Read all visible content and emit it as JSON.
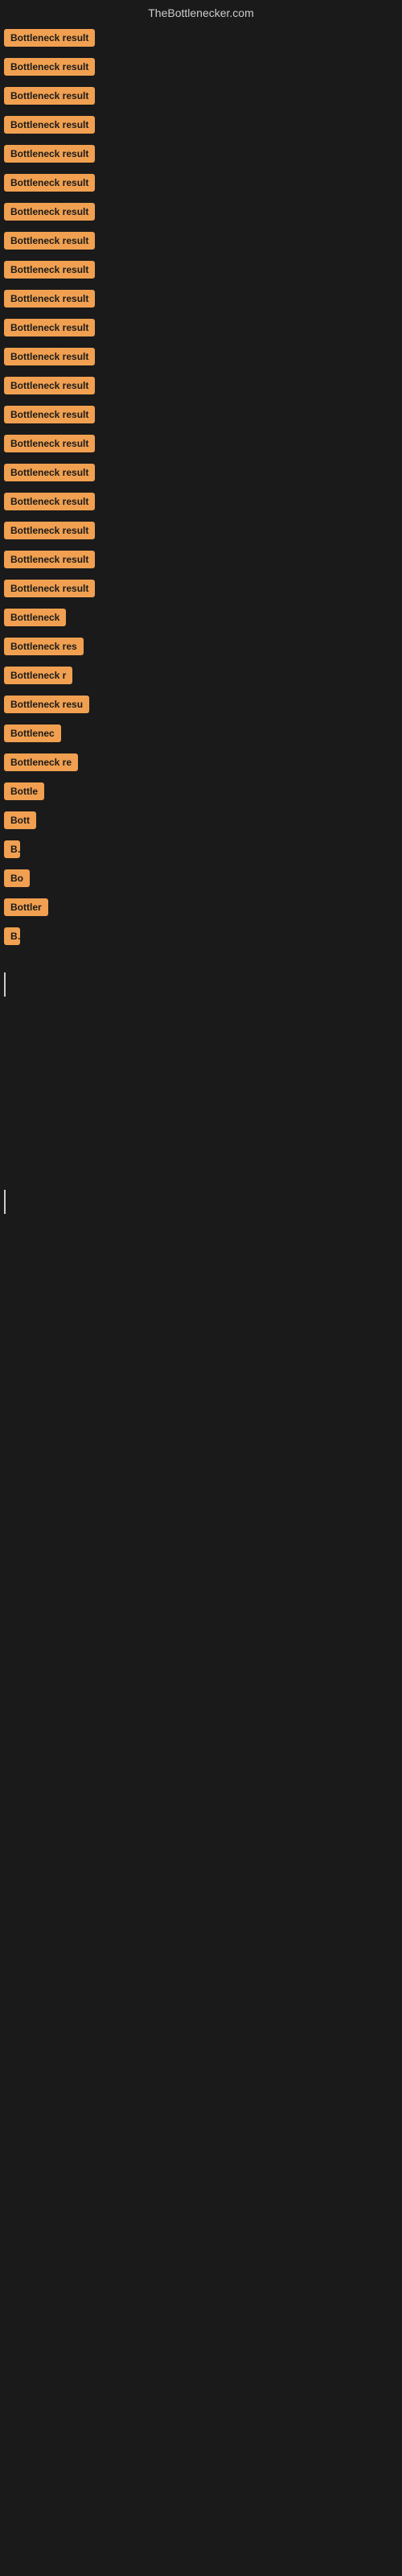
{
  "header": {
    "title": "TheBottlenecker.com"
  },
  "items": [
    {
      "label": "Bottleneck result",
      "width_class": "w-full"
    },
    {
      "label": "Bottleneck result",
      "width_class": "w-full"
    },
    {
      "label": "Bottleneck result",
      "width_class": "w-full"
    },
    {
      "label": "Bottleneck result",
      "width_class": "w-full"
    },
    {
      "label": "Bottleneck result",
      "width_class": "w-full"
    },
    {
      "label": "Bottleneck result",
      "width_class": "w-full"
    },
    {
      "label": "Bottleneck result",
      "width_class": "w-full"
    },
    {
      "label": "Bottleneck result",
      "width_class": "w-full"
    },
    {
      "label": "Bottleneck result",
      "width_class": "w-full"
    },
    {
      "label": "Bottleneck result",
      "width_class": "w-full"
    },
    {
      "label": "Bottleneck result",
      "width_class": "w-full"
    },
    {
      "label": "Bottleneck result",
      "width_class": "w-full"
    },
    {
      "label": "Bottleneck result",
      "width_class": "w-full"
    },
    {
      "label": "Bottleneck result",
      "width_class": "w-full"
    },
    {
      "label": "Bottleneck result",
      "width_class": "w-full"
    },
    {
      "label": "Bottleneck result",
      "width_class": "w-full"
    },
    {
      "label": "Bottleneck result",
      "width_class": "w-full"
    },
    {
      "label": "Bottleneck result",
      "width_class": "w-large"
    },
    {
      "label": "Bottleneck result",
      "width_class": "w-full"
    },
    {
      "label": "Bottleneck result",
      "width_class": "w-large"
    },
    {
      "label": "Bottleneck",
      "width_class": "w-medium"
    },
    {
      "label": "Bottleneck res",
      "width_class": "w-large"
    },
    {
      "label": "Bottleneck r",
      "width_class": "w-medium"
    },
    {
      "label": "Bottleneck resu",
      "width_class": "w-large"
    },
    {
      "label": "Bottlenec",
      "width_class": "w-medium"
    },
    {
      "label": "Bottleneck re",
      "width_class": "w-large"
    },
    {
      "label": "Bottle",
      "width_class": "w-small"
    },
    {
      "label": "Bott",
      "width_class": "w-small"
    },
    {
      "label": "B",
      "width_class": "w-xxxsmall"
    },
    {
      "label": "Bo",
      "width_class": "w-xsmall"
    },
    {
      "label": "Bottler",
      "width_class": "w-small"
    },
    {
      "label": "B",
      "width_class": "w-xxxsmall"
    }
  ]
}
